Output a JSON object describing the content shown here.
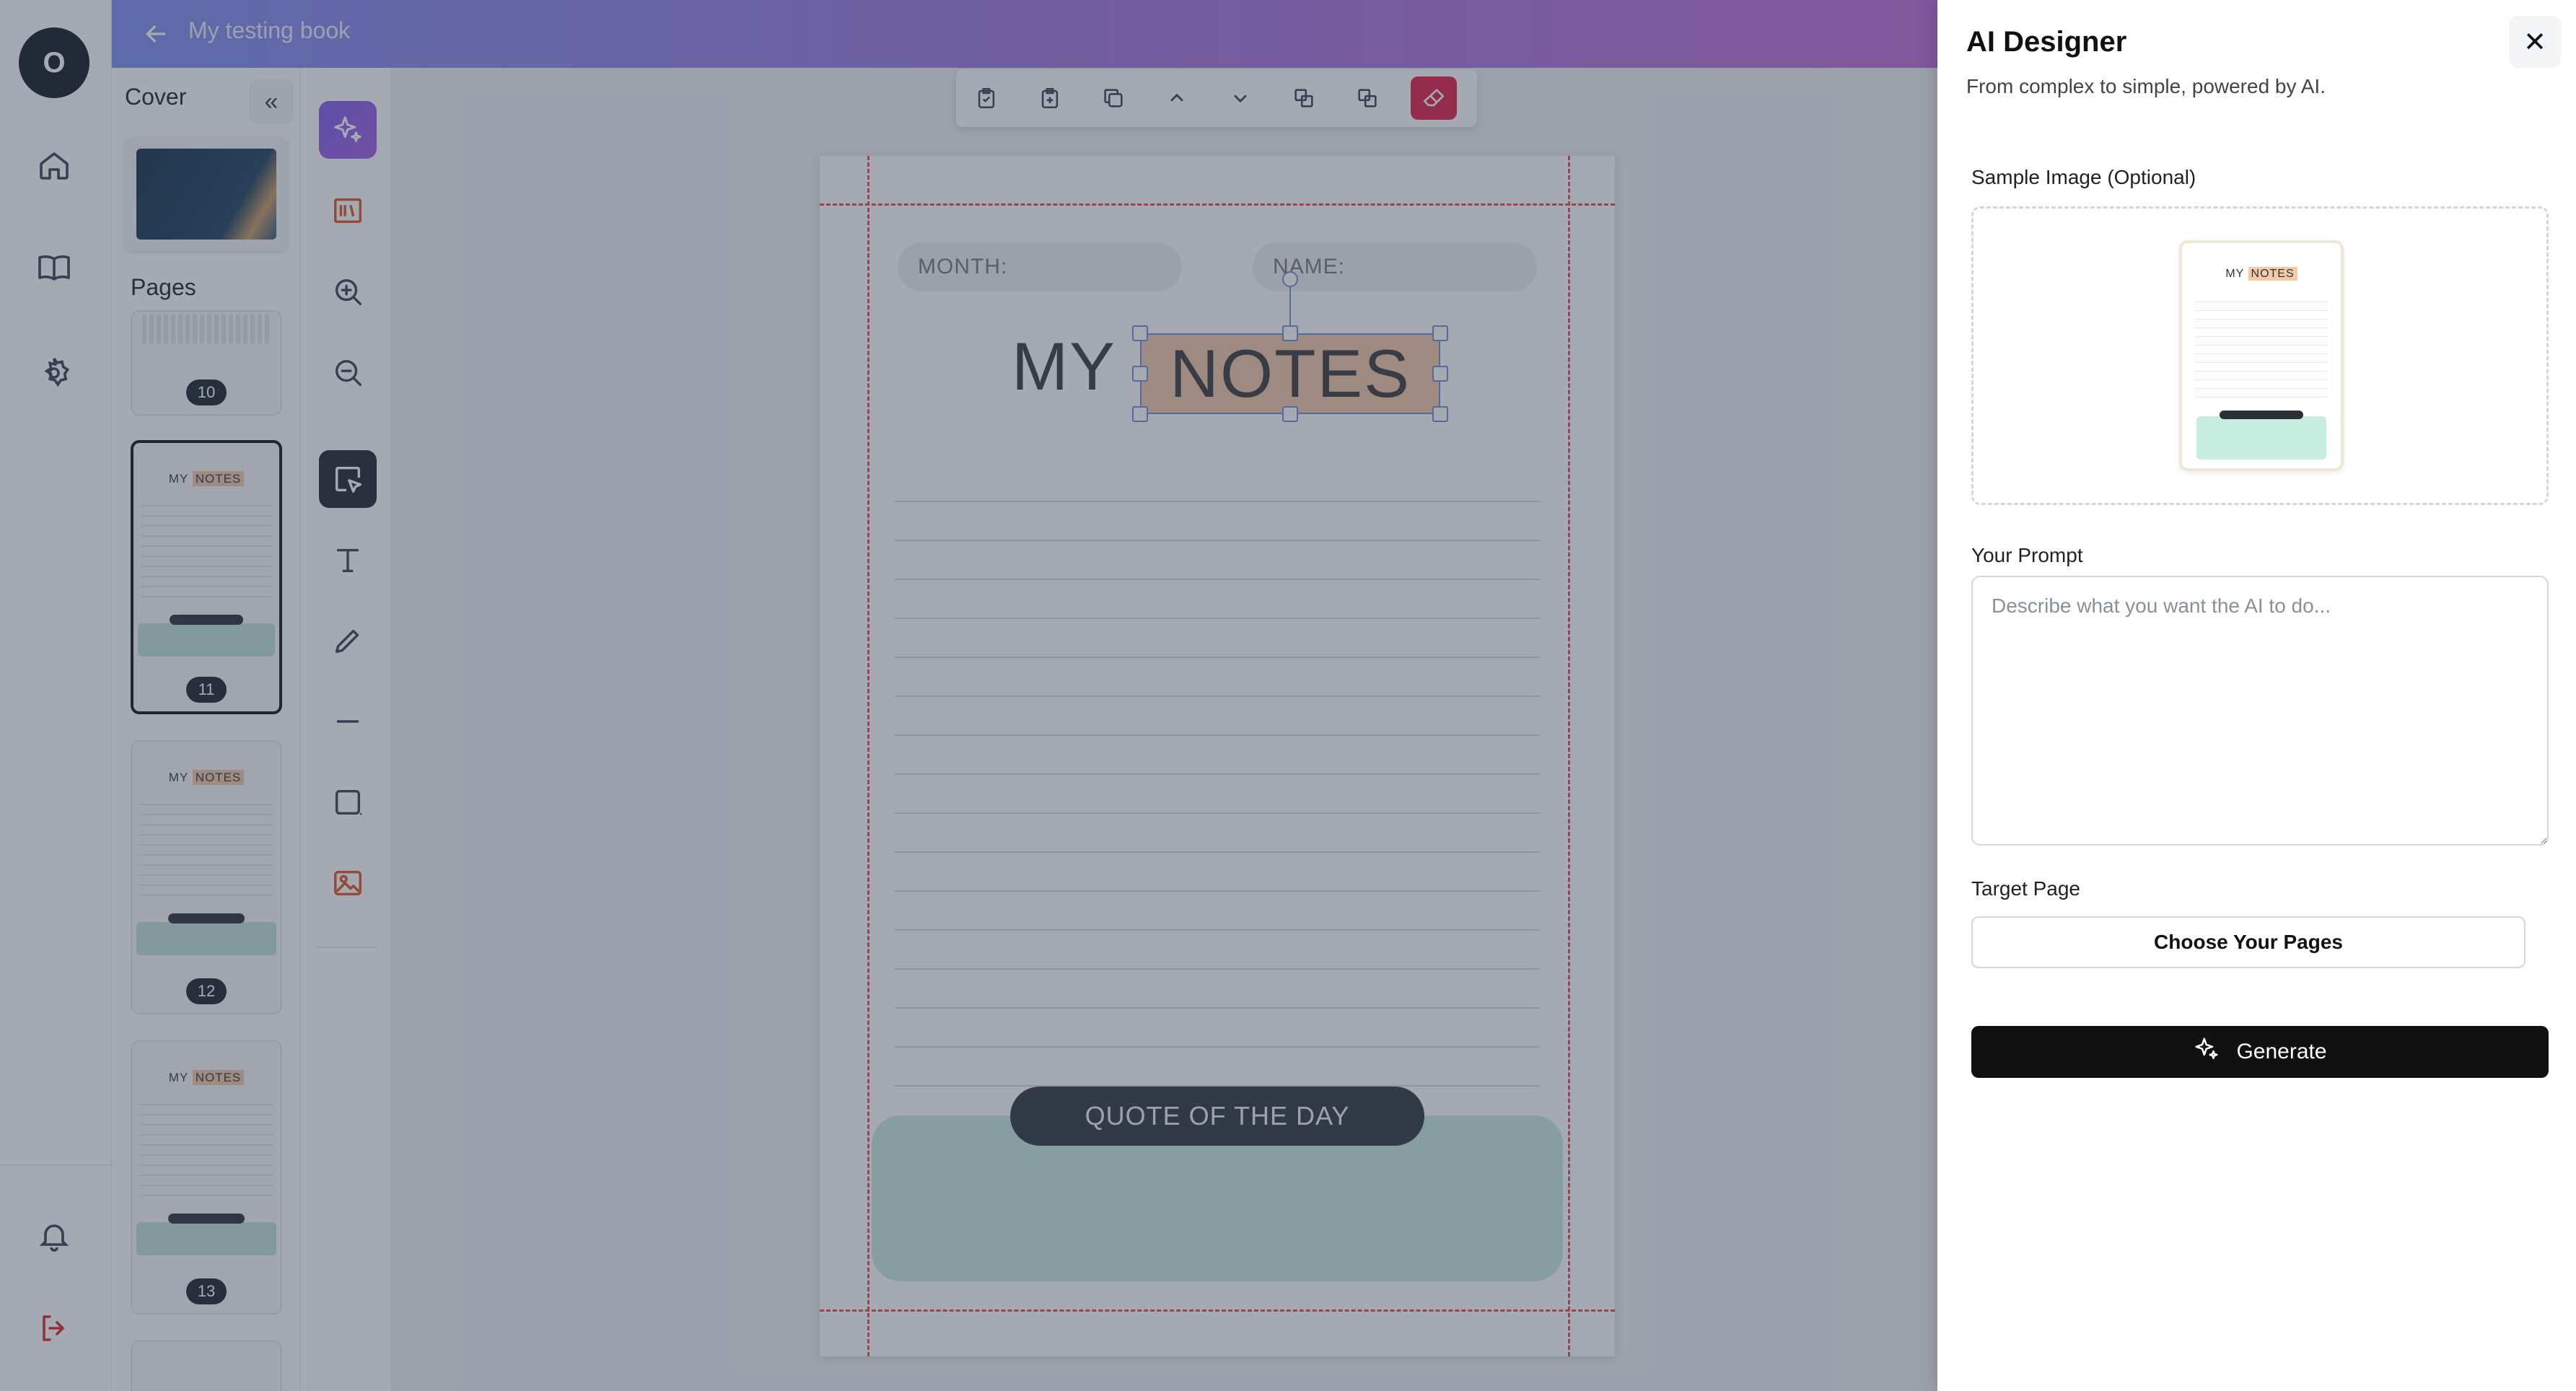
{
  "user": {
    "avatar_initial": "O"
  },
  "rail": {
    "icons": [
      "home-icon",
      "book-icon",
      "gear-icon",
      "bell-icon",
      "logout-icon"
    ]
  },
  "header": {
    "book_title": "My testing book"
  },
  "pages_panel": {
    "cover_label": "Cover",
    "collapse_label": "«",
    "pages_label": "Pages",
    "thumbnails": [
      {
        "number": "10",
        "selected": false
      },
      {
        "number": "11",
        "selected": true
      },
      {
        "number": "12",
        "selected": false
      },
      {
        "number": "13",
        "selected": false
      }
    ],
    "thumb_title_plain": "MY",
    "thumb_title_highlight": "NOTES"
  },
  "canvas": {
    "month_label": "MONTH:",
    "name_label": "NAME:",
    "heading_plain": "MY",
    "heading_highlight": "NOTES",
    "quote_label": "QUOTE OF THE DAY"
  },
  "drawer": {
    "title": "AI Designer",
    "subtitle": "From complex to simple, powered by AI.",
    "close_label": "✕",
    "sample_image_label": "Sample Image (Optional)",
    "sample_preview_plain": "MY",
    "sample_preview_highlight": "NOTES",
    "prompt_label": "Your Prompt",
    "prompt_placeholder": "Describe what you want the AI to do...",
    "prompt_value": "",
    "target_page_label": "Target Page",
    "choose_pages_label": "Choose Your Pages",
    "generate_label": "Generate"
  },
  "colors": {
    "accent_gradient_start": "#7d8ff0",
    "accent_gradient_end": "#c06bd9",
    "highlight": "#f5c7a7",
    "quote_box": "#c7ece0",
    "danger": "#e11d48",
    "primary_button": "#111111"
  }
}
